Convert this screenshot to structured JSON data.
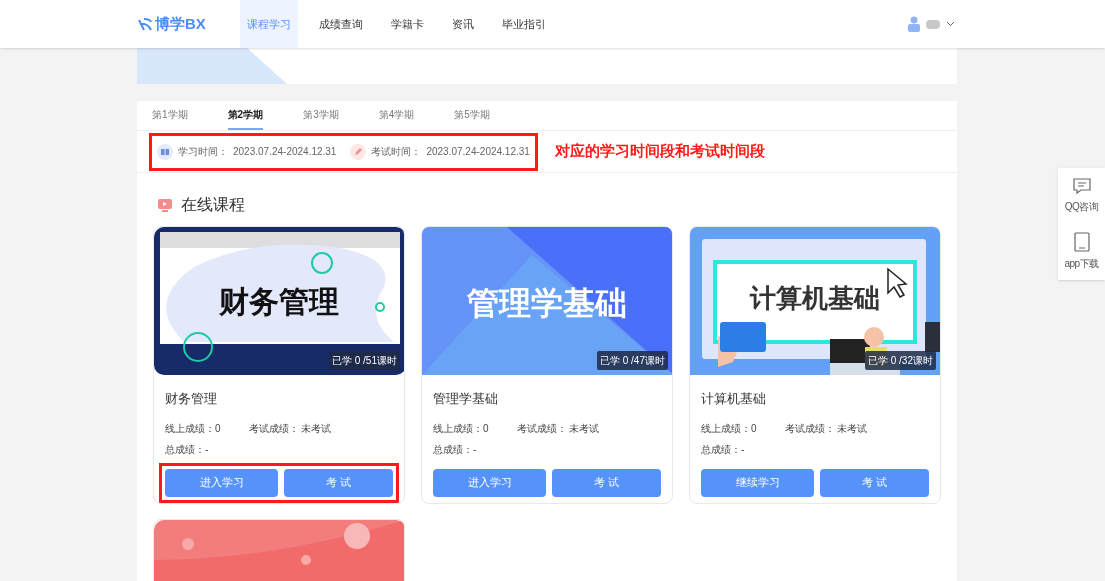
{
  "header": {
    "logo": "博学BX",
    "nav": [
      {
        "label": "课程学习",
        "selected": true
      },
      {
        "label": "成绩查询",
        "selected": false
      },
      {
        "label": "学籍卡",
        "selected": false
      },
      {
        "label": "资讯",
        "selected": false
      },
      {
        "label": "毕业指引",
        "selected": false
      }
    ]
  },
  "semesters": [
    {
      "label": "第1学期",
      "selected": false
    },
    {
      "label": "第2学期",
      "selected": true
    },
    {
      "label": "第3学期",
      "selected": false
    },
    {
      "label": "第4学期",
      "selected": false
    },
    {
      "label": "第5学期",
      "selected": false
    }
  ],
  "periods": {
    "highlighted": true,
    "items": [
      {
        "kind": "study",
        "label": "学习时间：",
        "value": "2023.07.24-2024.12.31"
      },
      {
        "kind": "exam",
        "label": "考试时间：",
        "value": "2023.07.24-2024.12.31"
      }
    ],
    "annotation": "对应的学习时间段和考试时间段"
  },
  "section_title": "在线课程",
  "courses": [
    {
      "kind": "finance",
      "cover_title": "财务管理",
      "progress": "已学 0 /51课时",
      "title": "财务管理",
      "online_score": "线上成绩：0",
      "exam_score": "考试成绩： 未考试",
      "total": "总成绩：-",
      "buttons": [
        "进入学习",
        "考 试"
      ],
      "highlighted": true
    },
    {
      "kind": "management",
      "cover_title": "管理学基础",
      "progress": "已学 0 /47课时",
      "title": "管理学基础",
      "online_score": "线上成绩：0",
      "exam_score": "考试成绩： 未考试",
      "total": "总成绩：-",
      "buttons": [
        "进入学习",
        "考 试"
      ],
      "highlighted": false
    },
    {
      "kind": "computer",
      "cover_title": "计算机基础",
      "progress": "已学 0 /32课时",
      "title": "计算机基础",
      "online_score": "线上成绩：0",
      "exam_score": "考试成绩： 未考试",
      "total": "总成绩：-",
      "buttons": [
        "继续学习",
        "考 试"
      ],
      "highlighted": false
    },
    {
      "kind": "policy"
    }
  ],
  "side_tools": [
    {
      "kind": "chat",
      "label": "QQ咨询"
    },
    {
      "kind": "tablet",
      "label": "app下载"
    }
  ]
}
